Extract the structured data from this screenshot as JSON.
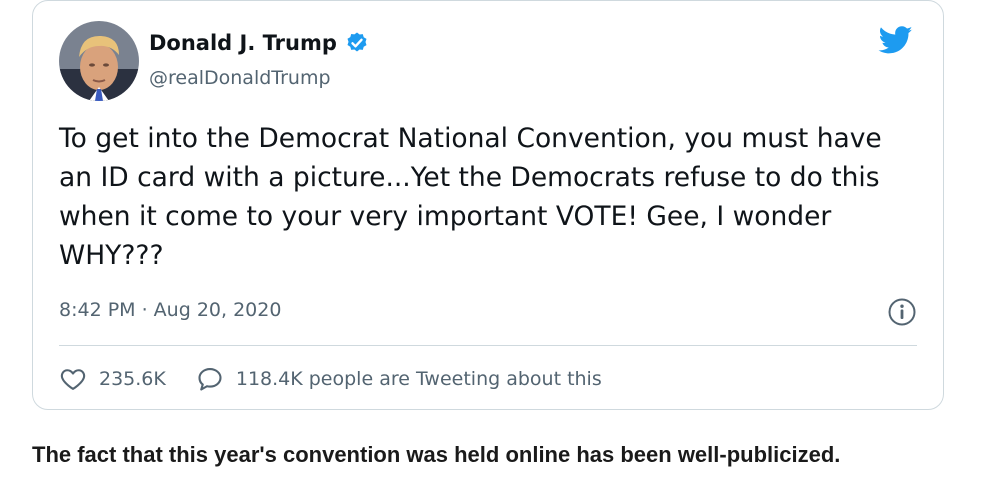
{
  "tweet": {
    "display_name": "Donald J. Trump",
    "handle": "@realDonaldTrump",
    "text": "To get into the Democrat National Convention, you must have an ID card with a picture...Yet the Democrats refuse to do this when it come to your very important VOTE! Gee, I wonder WHY???",
    "timestamp": "8:42 PM · Aug 20, 2020",
    "likes": "235.6K",
    "retweets_text": "118.4K people are Tweeting about this"
  },
  "icons": {
    "brand": "twitter-bird-icon",
    "verified": "verified-badge-icon",
    "info": "info-icon",
    "like": "heart-icon",
    "reply": "speech-bubble-icon"
  },
  "colors": {
    "twitter_blue": "#1d9bf0",
    "text_primary": "#0f1419",
    "text_secondary": "#536471",
    "border": "#cfd9de"
  },
  "caption": "The fact that this year's convention was held online has been well-publicized."
}
